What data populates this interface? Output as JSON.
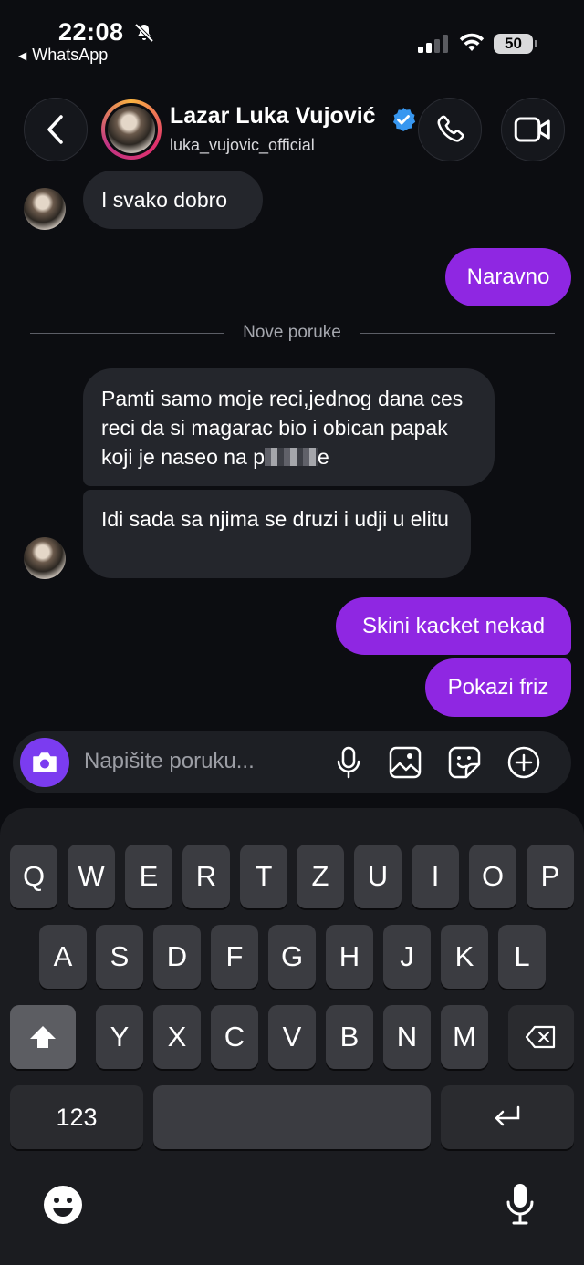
{
  "status_bar": {
    "time": "22:08",
    "back_app": "WhatsApp",
    "battery": "50"
  },
  "header": {
    "name": "Lazar Luka Vujović",
    "handle": "luka_vujovic_official"
  },
  "messages": [
    {
      "direction": "in",
      "text": "I svako dobro"
    },
    {
      "direction": "out",
      "text": "Naravno"
    },
    {
      "direction": "in",
      "text_before": "Pamti samo moje reci,jednog dana ces reci da si magarac bio i obican papak koji je naseo na p",
      "text_after": "e"
    },
    {
      "direction": "in",
      "text": "Idi sada sa njima se druzi i udji u elitu"
    },
    {
      "direction": "out",
      "text": "Skini kacket nekad"
    },
    {
      "direction": "out",
      "text": "Pokazi friz"
    }
  ],
  "divider": "Nove poruke",
  "composer": {
    "placeholder": "Napišite poruku..."
  },
  "keyboard": {
    "row1": [
      "Q",
      "W",
      "E",
      "R",
      "T",
      "Z",
      "U",
      "I",
      "O",
      "P"
    ],
    "row2": [
      "A",
      "S",
      "D",
      "F",
      "G",
      "H",
      "J",
      "K",
      "L"
    ],
    "row3": [
      "Y",
      "X",
      "C",
      "V",
      "B",
      "N",
      "M"
    ],
    "numbers_label": "123"
  },
  "colors": {
    "outgoing_bubble": "#8f27e2",
    "incoming_bubble": "#24262c",
    "camera_button": "#7b3cf0",
    "verified_badge": "#3897f0"
  }
}
